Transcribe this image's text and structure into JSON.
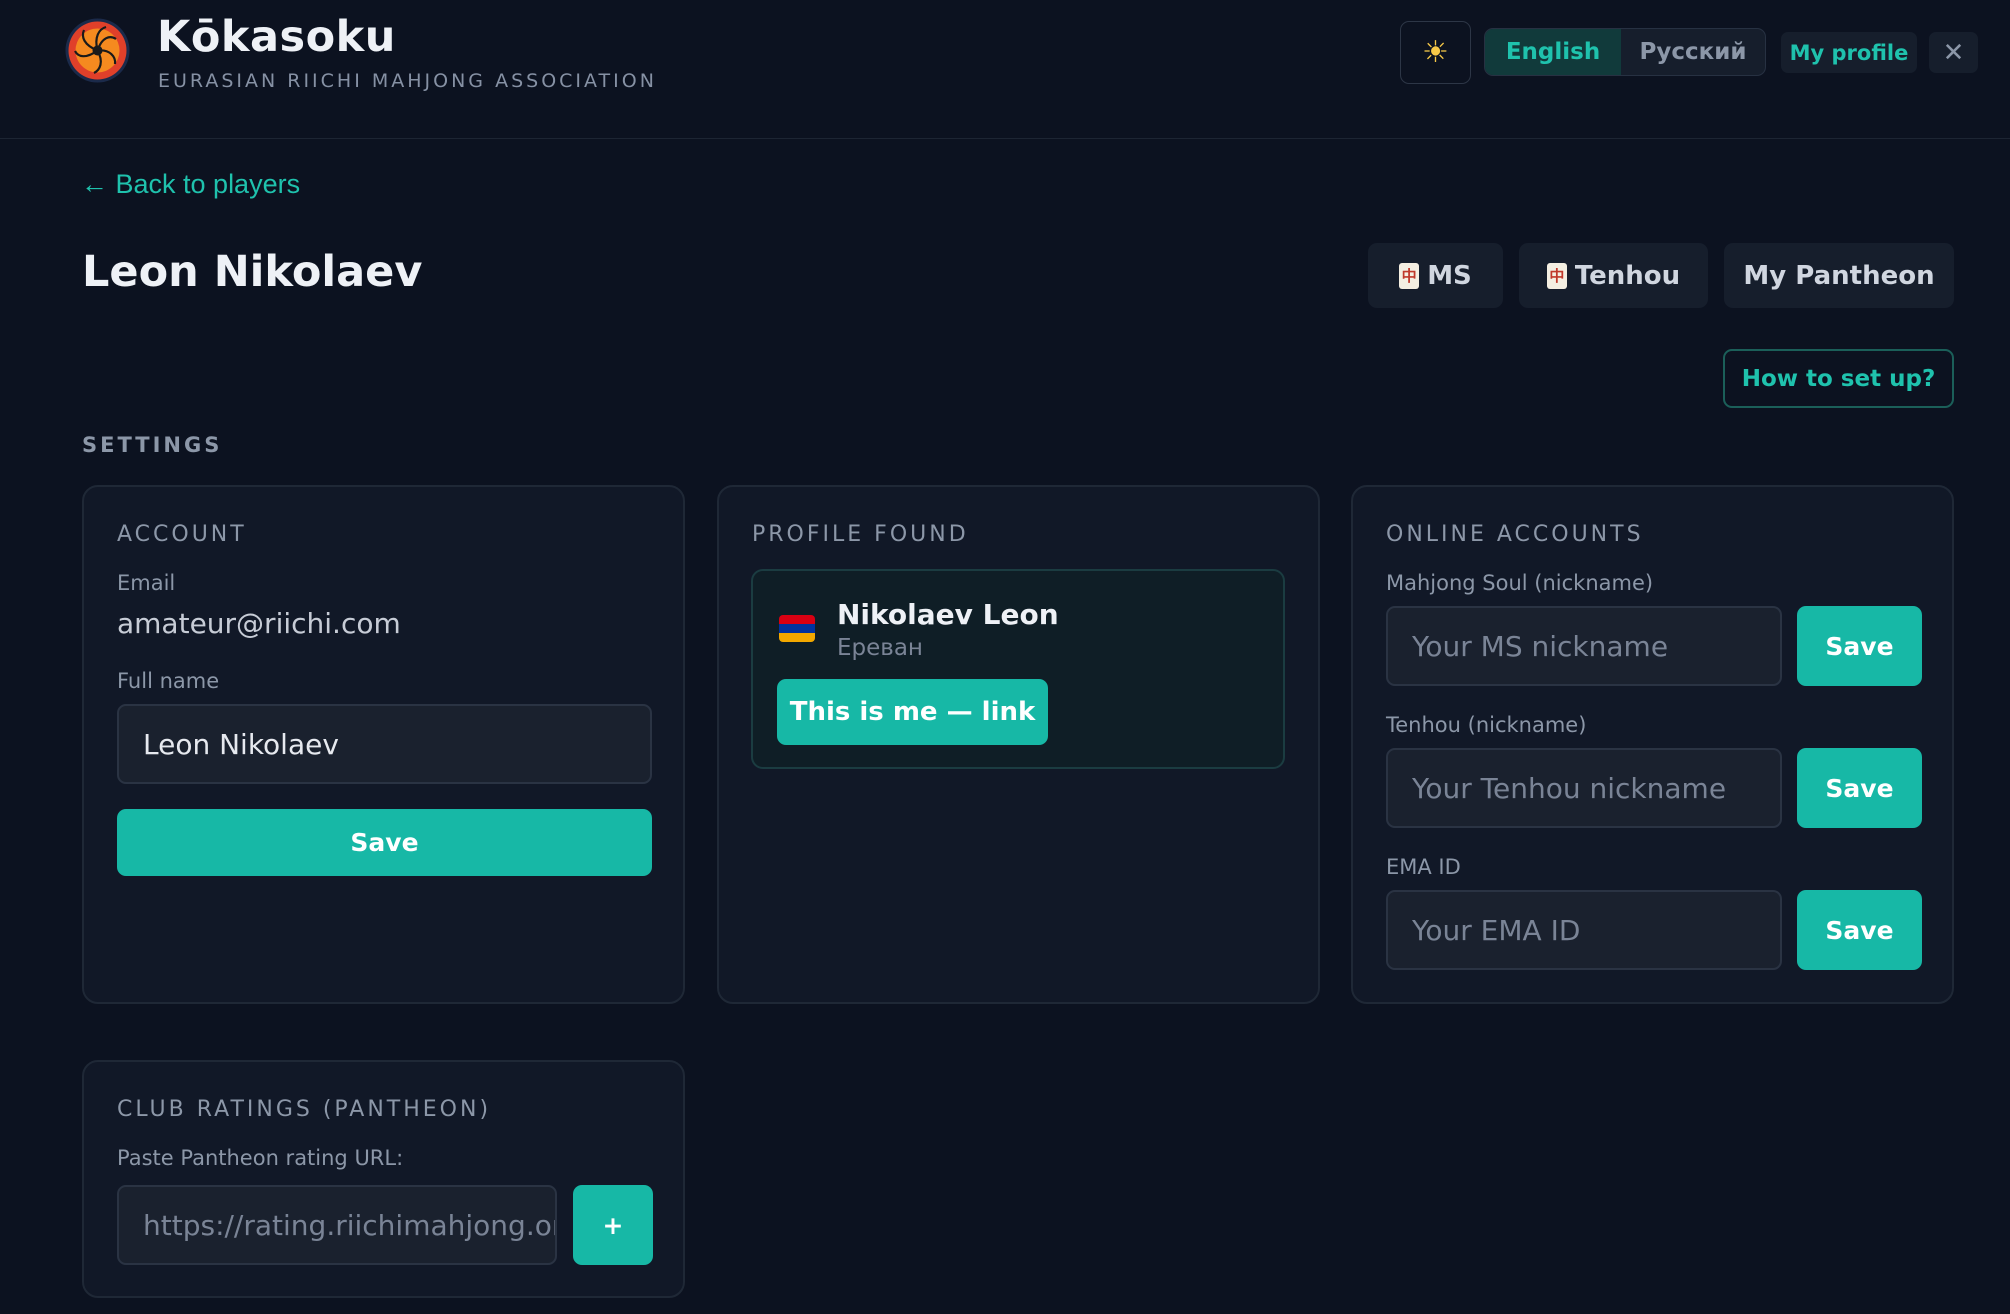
{
  "header": {
    "app_name": "Kōkasoku",
    "subtitle": "EURASIAN RIICHI MAHJONG ASSOCIATION",
    "theme_icon": "sun-icon",
    "languages": [
      "English",
      "Русский"
    ],
    "active_language": "English",
    "my_profile_label": "My profile",
    "close_icon": "close-icon"
  },
  "page": {
    "back_link": "← Back to players",
    "player_name": "Leon Nikolaev",
    "external_buttons": {
      "ms_label": "MS",
      "tenhou_label": "Tenhou",
      "pantheon_label": "My Pantheon"
    },
    "howto_label": "How to set up?",
    "settings_label": "SETTINGS"
  },
  "account": {
    "title": "ACCOUNT",
    "email_label": "Email",
    "email_value": "amateur@riichi.com",
    "fullname_label": "Full name",
    "fullname_value": "Leon Nikolaev",
    "save_label": "Save"
  },
  "profile_found": {
    "title": "PROFILE FOUND",
    "name": "Nikolaev Leon",
    "city": "Ереван",
    "flag": "armenia-flag",
    "link_label": "This is me — link"
  },
  "online_accounts": {
    "title": "ONLINE ACCOUNTS",
    "ms_label": "Mahjong Soul (nickname)",
    "ms_placeholder": "Your MS nickname",
    "tenhou_label": "Tenhou (nickname)",
    "tenhou_placeholder": "Your Tenhou nickname",
    "ema_label": "EMA ID",
    "ema_placeholder": "Your EMA ID",
    "save_label": "Save"
  },
  "club_ratings": {
    "title": "CLUB RATINGS (PANTHEON)",
    "url_label": "Paste Pantheon rating URL:",
    "url_placeholder": "https://rating.riichimahjong.org",
    "add_label": "+"
  },
  "colors": {
    "background": "#0c1220",
    "card": "#111827",
    "accent": "#17b8a6",
    "link": "#1fc2ad"
  }
}
